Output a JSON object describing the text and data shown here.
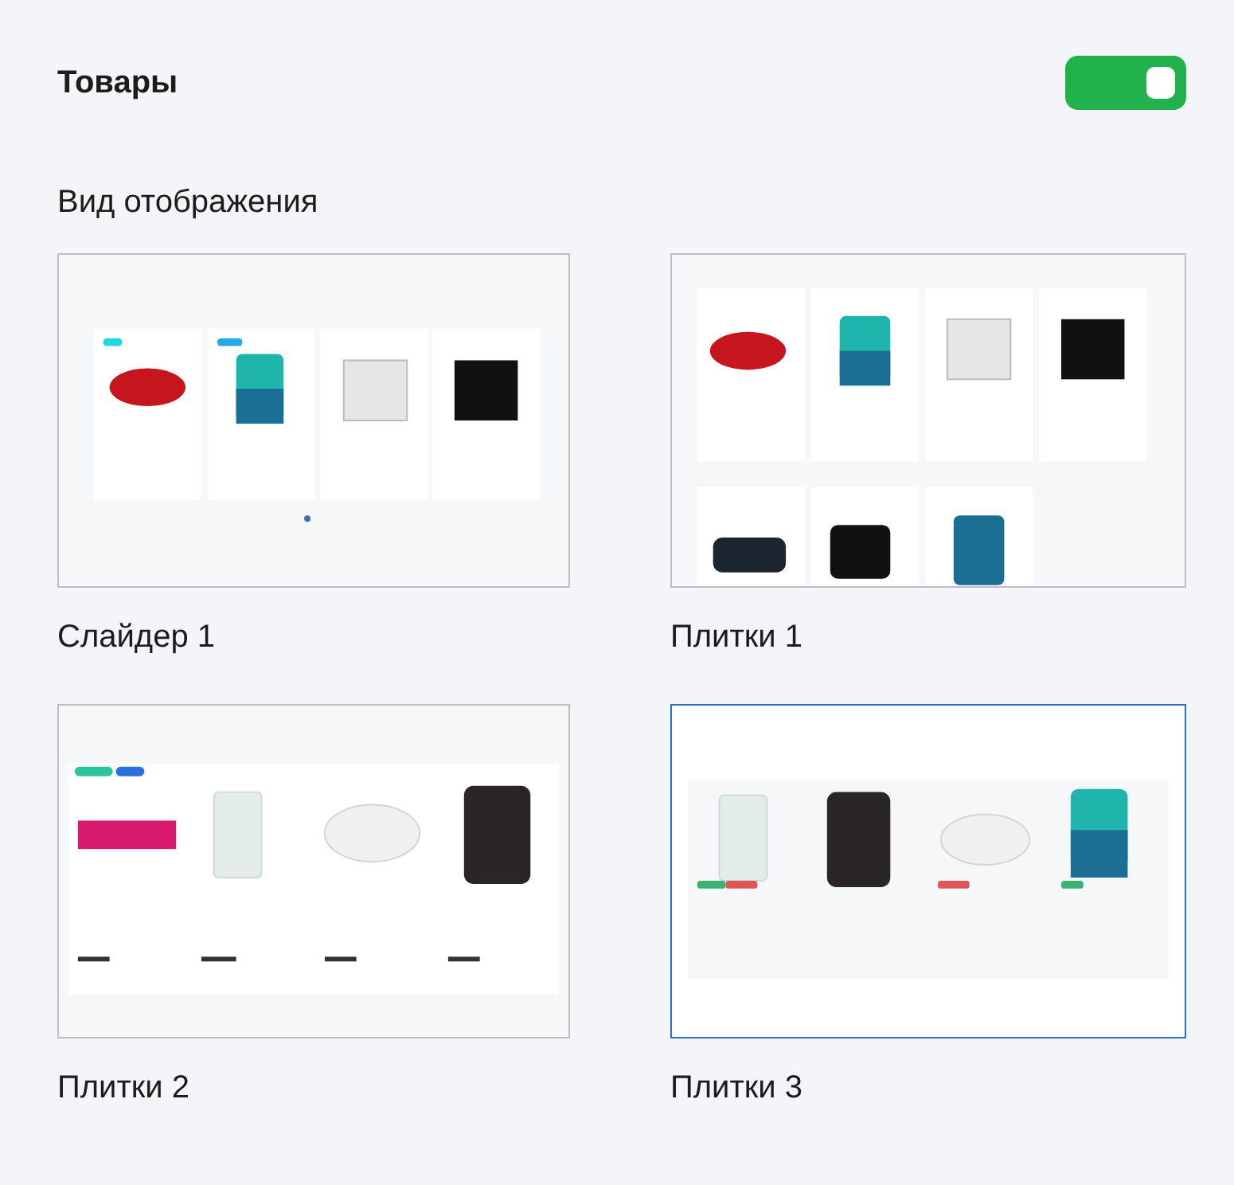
{
  "section": {
    "title": "Товары",
    "toggle": {
      "on": true
    }
  },
  "display": {
    "title": "Вид отображения",
    "layouts": [
      {
        "label": "Слайдер 1",
        "selected": false,
        "kind": "picture"
      },
      {
        "label": "Плитки 1",
        "selected": false,
        "kind": "picture"
      },
      {
        "label": "Плитки 2",
        "selected": false,
        "kind": "picture"
      },
      {
        "label": "Плитки 3",
        "selected": true,
        "kind": "picture"
      }
    ]
  }
}
